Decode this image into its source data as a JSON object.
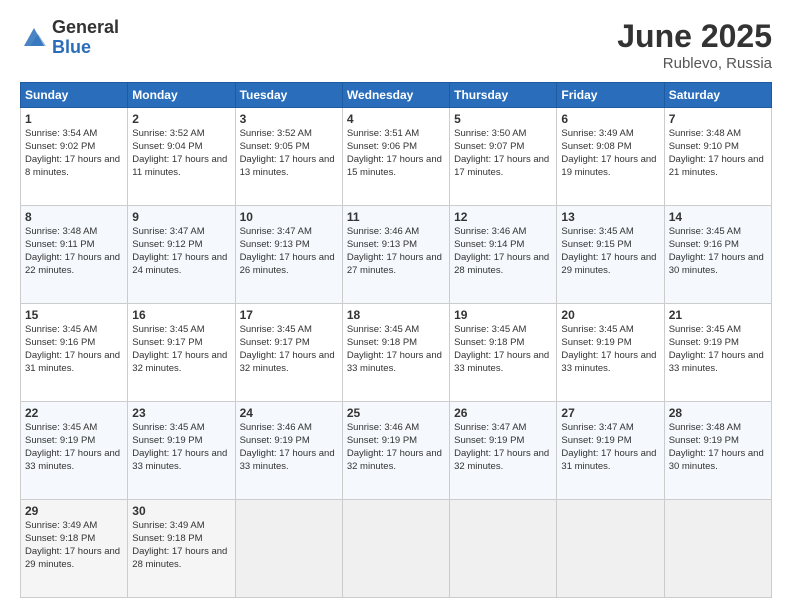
{
  "header": {
    "logo_general": "General",
    "logo_blue": "Blue",
    "title": "June 2025",
    "location": "Rublevo, Russia"
  },
  "days_header": [
    "Sunday",
    "Monday",
    "Tuesday",
    "Wednesday",
    "Thursday",
    "Friday",
    "Saturday"
  ],
  "weeks": [
    [
      {
        "day": "1",
        "sunrise": "3:54 AM",
        "sunset": "9:02 PM",
        "daylight": "17 hours and 8 minutes."
      },
      {
        "day": "2",
        "sunrise": "3:52 AM",
        "sunset": "9:04 PM",
        "daylight": "17 hours and 11 minutes."
      },
      {
        "day": "3",
        "sunrise": "3:52 AM",
        "sunset": "9:05 PM",
        "daylight": "17 hours and 13 minutes."
      },
      {
        "day": "4",
        "sunrise": "3:51 AM",
        "sunset": "9:06 PM",
        "daylight": "17 hours and 15 minutes."
      },
      {
        "day": "5",
        "sunrise": "3:50 AM",
        "sunset": "9:07 PM",
        "daylight": "17 hours and 17 minutes."
      },
      {
        "day": "6",
        "sunrise": "3:49 AM",
        "sunset": "9:08 PM",
        "daylight": "17 hours and 19 minutes."
      },
      {
        "day": "7",
        "sunrise": "3:48 AM",
        "sunset": "9:10 PM",
        "daylight": "17 hours and 21 minutes."
      }
    ],
    [
      {
        "day": "8",
        "sunrise": "3:48 AM",
        "sunset": "9:11 PM",
        "daylight": "17 hours and 22 minutes."
      },
      {
        "day": "9",
        "sunrise": "3:47 AM",
        "sunset": "9:12 PM",
        "daylight": "17 hours and 24 minutes."
      },
      {
        "day": "10",
        "sunrise": "3:47 AM",
        "sunset": "9:13 PM",
        "daylight": "17 hours and 26 minutes."
      },
      {
        "day": "11",
        "sunrise": "3:46 AM",
        "sunset": "9:13 PM",
        "daylight": "17 hours and 27 minutes."
      },
      {
        "day": "12",
        "sunrise": "3:46 AM",
        "sunset": "9:14 PM",
        "daylight": "17 hours and 28 minutes."
      },
      {
        "day": "13",
        "sunrise": "3:45 AM",
        "sunset": "9:15 PM",
        "daylight": "17 hours and 29 minutes."
      },
      {
        "day": "14",
        "sunrise": "3:45 AM",
        "sunset": "9:16 PM",
        "daylight": "17 hours and 30 minutes."
      }
    ],
    [
      {
        "day": "15",
        "sunrise": "3:45 AM",
        "sunset": "9:16 PM",
        "daylight": "17 hours and 31 minutes."
      },
      {
        "day": "16",
        "sunrise": "3:45 AM",
        "sunset": "9:17 PM",
        "daylight": "17 hours and 32 minutes."
      },
      {
        "day": "17",
        "sunrise": "3:45 AM",
        "sunset": "9:17 PM",
        "daylight": "17 hours and 32 minutes."
      },
      {
        "day": "18",
        "sunrise": "3:45 AM",
        "sunset": "9:18 PM",
        "daylight": "17 hours and 33 minutes."
      },
      {
        "day": "19",
        "sunrise": "3:45 AM",
        "sunset": "9:18 PM",
        "daylight": "17 hours and 33 minutes."
      },
      {
        "day": "20",
        "sunrise": "3:45 AM",
        "sunset": "9:19 PM",
        "daylight": "17 hours and 33 minutes."
      },
      {
        "day": "21",
        "sunrise": "3:45 AM",
        "sunset": "9:19 PM",
        "daylight": "17 hours and 33 minutes."
      }
    ],
    [
      {
        "day": "22",
        "sunrise": "3:45 AM",
        "sunset": "9:19 PM",
        "daylight": "17 hours and 33 minutes."
      },
      {
        "day": "23",
        "sunrise": "3:45 AM",
        "sunset": "9:19 PM",
        "daylight": "17 hours and 33 minutes."
      },
      {
        "day": "24",
        "sunrise": "3:46 AM",
        "sunset": "9:19 PM",
        "daylight": "17 hours and 33 minutes."
      },
      {
        "day": "25",
        "sunrise": "3:46 AM",
        "sunset": "9:19 PM",
        "daylight": "17 hours and 32 minutes."
      },
      {
        "day": "26",
        "sunrise": "3:47 AM",
        "sunset": "9:19 PM",
        "daylight": "17 hours and 32 minutes."
      },
      {
        "day": "27",
        "sunrise": "3:47 AM",
        "sunset": "9:19 PM",
        "daylight": "17 hours and 31 minutes."
      },
      {
        "day": "28",
        "sunrise": "3:48 AM",
        "sunset": "9:19 PM",
        "daylight": "17 hours and 30 minutes."
      }
    ],
    [
      {
        "day": "29",
        "sunrise": "3:49 AM",
        "sunset": "9:18 PM",
        "daylight": "17 hours and 29 minutes."
      },
      {
        "day": "30",
        "sunrise": "3:49 AM",
        "sunset": "9:18 PM",
        "daylight": "17 hours and 28 minutes."
      },
      null,
      null,
      null,
      null,
      null
    ]
  ]
}
